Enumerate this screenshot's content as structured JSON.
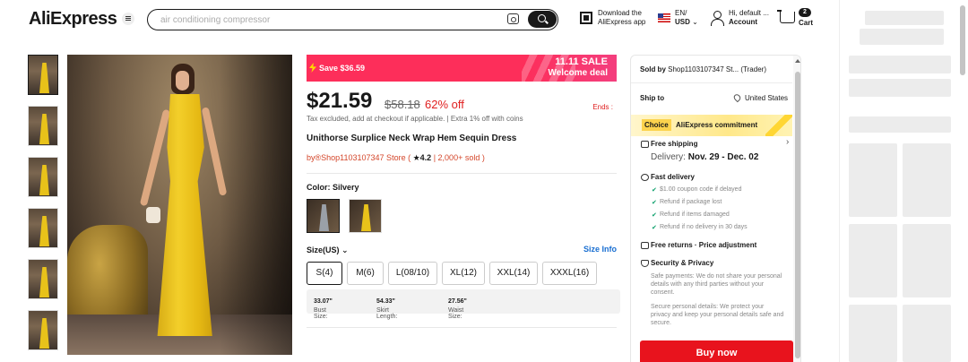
{
  "header": {
    "logo": "AliExpress",
    "search_placeholder": "air conditioning compressor",
    "app_line1": "Download the",
    "app_line2": "AliExpress app",
    "locale_line1": "EN/",
    "locale_line2": "USD",
    "account_line1": "Hi, default ...",
    "account_line2": "Account",
    "cart_count": "2",
    "cart_label": "Cart"
  },
  "promo": {
    "save": "Save $36.59",
    "sale": "11.11 SALE",
    "deal": "Welcome deal"
  },
  "product": {
    "price": "$21.59",
    "original_price": "$58.18",
    "discount": "62% off",
    "ends": "Ends :",
    "tax_note": "Tax excluded, add at checkout if applicable. | Extra 1% off with coins",
    "title": "Unithorse Surplice Neck Wrap Hem Sequin Dress",
    "store_prefix": "by",
    "store_name": "Shop1103107347 Store",
    "rating": "4.2",
    "sold": "2,000+ sold",
    "color_label": "Color: Silvery",
    "size_label": "Size(US)",
    "size_info": "Size Info",
    "sizes": [
      "S(4)",
      "M(6)",
      "L(08/10)",
      "XL(12)",
      "XXL(14)",
      "XXXL(16)"
    ],
    "bust_label": "Bust Size:",
    "bust_value": "33.07\"",
    "skirt_label": "Skirt Length:",
    "skirt_value": "54.33\"",
    "waist_label": "Waist Size:",
    "waist_value": "27.56\""
  },
  "panel": {
    "sold_by_label": "Sold by",
    "sold_by_value": "Shop1103107347 St...",
    "sold_by_type": "(Trader)",
    "ship_to_label": "Ship to",
    "ship_to_value": "United States",
    "choice_tag": "Choice",
    "commitment": "AliExpress commitment",
    "free_shipping": "Free shipping",
    "delivery_label": "Delivery:",
    "delivery_dates": "Nov. 29 - Dec. 02",
    "fast_delivery": "Fast delivery",
    "fast_items": [
      "$1.00 coupon code if delayed",
      "Refund if package lost",
      "Refund if items damaged",
      "Refund if no delivery in 30 days"
    ],
    "returns": "Free returns · Price adjustment",
    "security": "Security & Privacy",
    "security_note1": "Safe payments: We do not share your personal details with any third parties without your consent.",
    "security_note2": "Secure personal details: We protect your privacy and keep your personal details safe and secure.",
    "buy_now": "Buy now"
  },
  "colors": {
    "accent": "#e8131d",
    "promo": "#fd2e5a",
    "link": "#1a6fd1",
    "choice": "#fcd34d"
  }
}
